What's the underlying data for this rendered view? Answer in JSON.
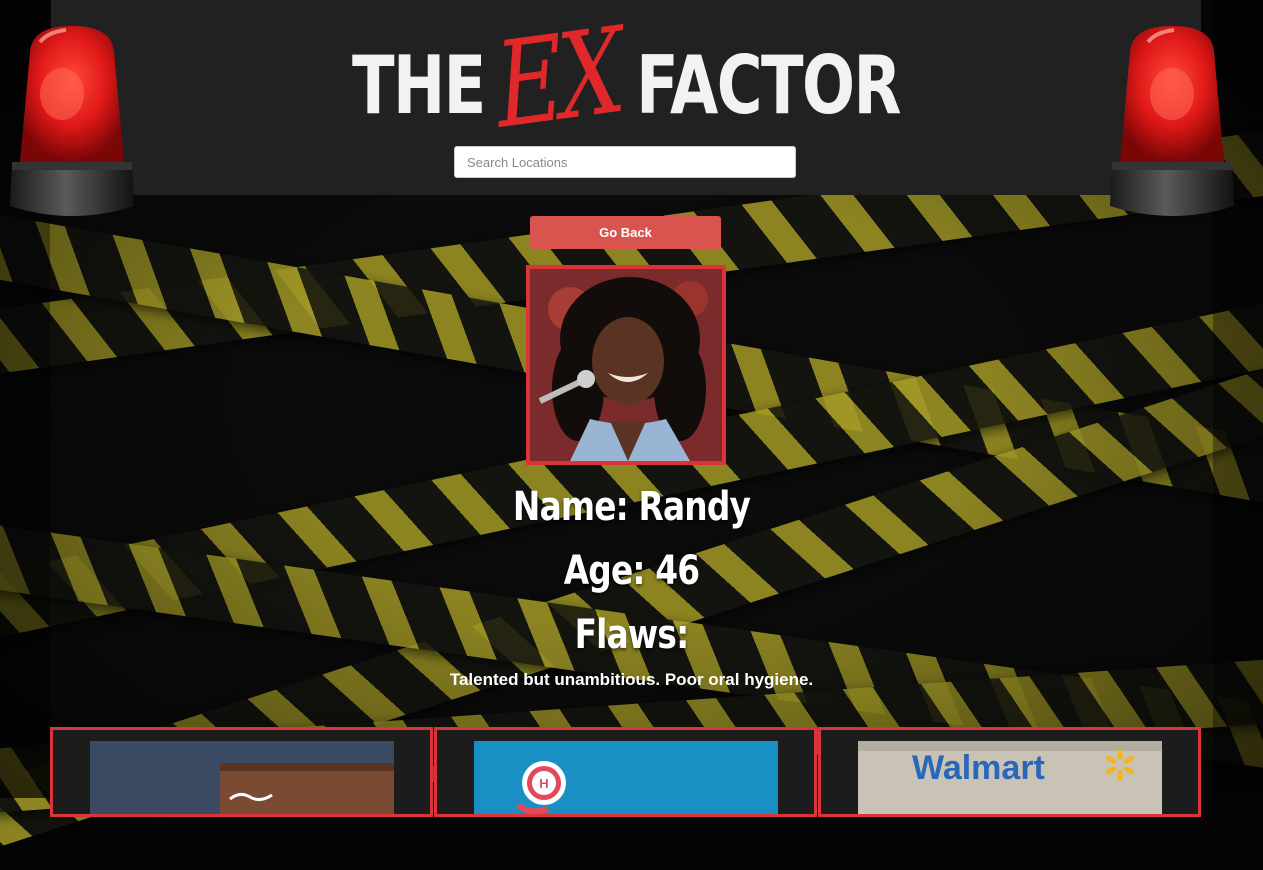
{
  "header": {
    "logo_pre": "THE",
    "logo_ex": "EX",
    "logo_post": "FACTOR",
    "search_placeholder": "Search Locations"
  },
  "actions": {
    "go_back_label": "Go Back"
  },
  "profile": {
    "name_line": "Name: Randy",
    "age_line": "Age: 46",
    "flaws_heading": "Flaws:",
    "flaws_text": "Talented but unambitious. Poor oral hygiene."
  },
  "locations": [
    {
      "logo_text": ""
    },
    {
      "logo_text": "H"
    },
    {
      "logo_text": "Walmart"
    }
  ],
  "colors": {
    "accent": "#d9534f",
    "frame": "#d9343a",
    "header_bg": "#212121",
    "tape_yellow": "#a39a26"
  },
  "icons": [
    "siren-icon",
    "walmart-spark-icon"
  ]
}
